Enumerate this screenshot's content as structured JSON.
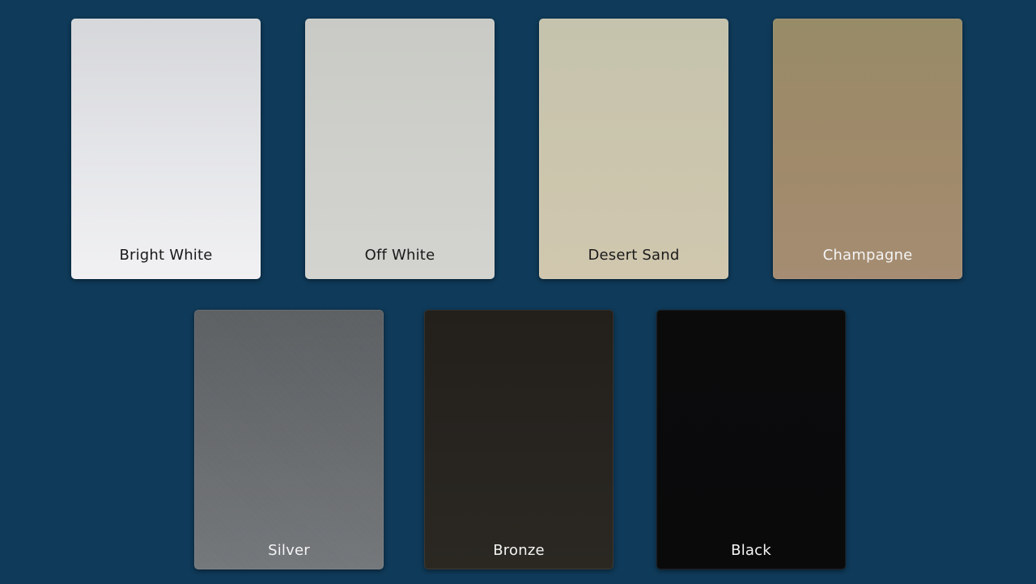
{
  "swatches": [
    {
      "label": "Bright White",
      "color": "#e4e5e8"
    },
    {
      "label": "Off White",
      "color": "#cfd0cb"
    },
    {
      "label": "Desert Sand",
      "color": "#cbc5ad"
    },
    {
      "label": "Champagne",
      "color": "#9f8a6a"
    },
    {
      "label": "Silver",
      "color": "#686b6e"
    },
    {
      "label": "Bronze",
      "color": "#272420"
    },
    {
      "label": "Black",
      "color": "#0a0a0b"
    }
  ],
  "background_color": "#0f3a59"
}
